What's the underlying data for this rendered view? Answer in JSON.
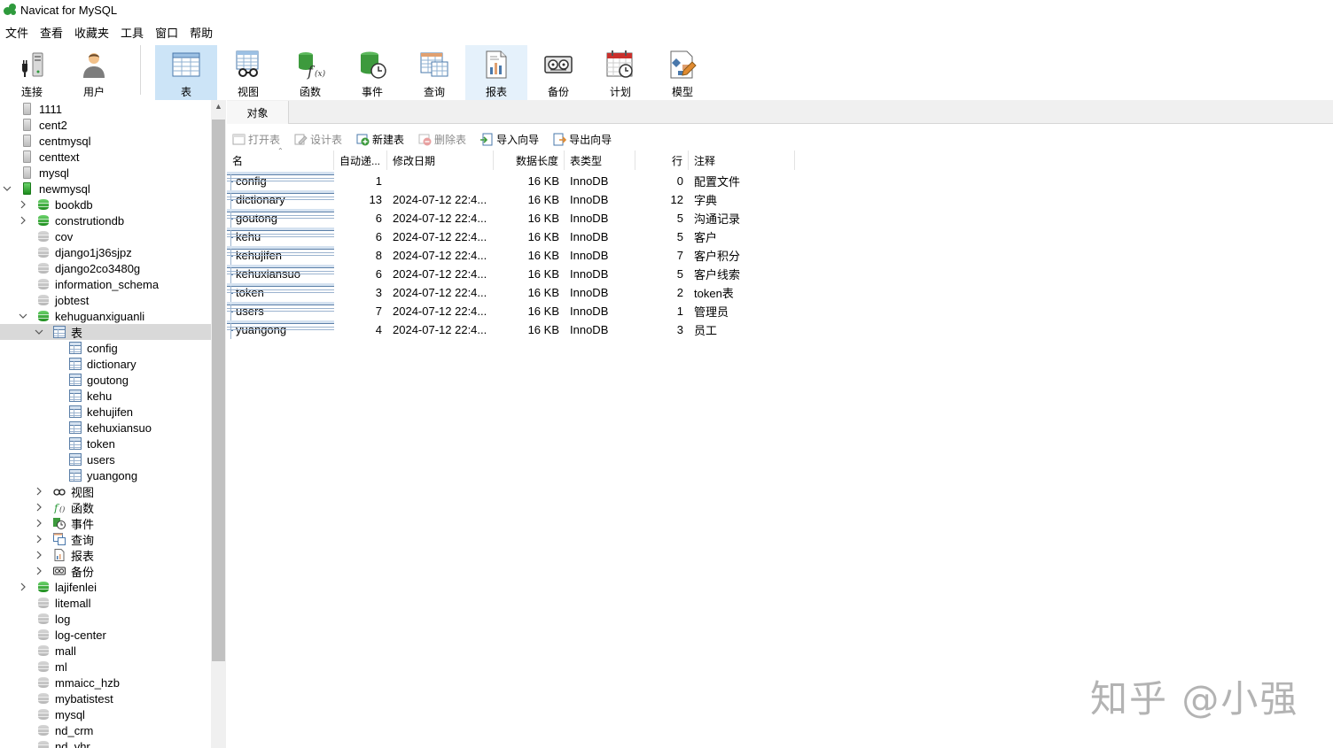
{
  "window": {
    "title": "Navicat for MySQL"
  },
  "menu": [
    "文件",
    "查看",
    "收藏夹",
    "工具",
    "窗口",
    "帮助"
  ],
  "toolbar": [
    {
      "key": "connect",
      "label": "连接"
    },
    {
      "key": "user",
      "label": "用户"
    },
    {
      "key": "table",
      "label": "表",
      "active": true
    },
    {
      "key": "view",
      "label": "视图"
    },
    {
      "key": "function",
      "label": "函数"
    },
    {
      "key": "event",
      "label": "事件"
    },
    {
      "key": "query",
      "label": "查询"
    },
    {
      "key": "report",
      "label": "报表",
      "hover": true
    },
    {
      "key": "backup",
      "label": "备份"
    },
    {
      "key": "schedule",
      "label": "计划"
    },
    {
      "key": "model",
      "label": "模型"
    }
  ],
  "tree": [
    {
      "label": "1111",
      "level": 0,
      "kind": "server"
    },
    {
      "label": "cent2",
      "level": 0,
      "kind": "server"
    },
    {
      "label": "centmysql",
      "level": 0,
      "kind": "server"
    },
    {
      "label": "centtext",
      "level": 0,
      "kind": "server"
    },
    {
      "label": "mysql",
      "level": 0,
      "kind": "server"
    },
    {
      "label": "newmysql",
      "level": 0,
      "kind": "server-on",
      "expanded": true
    },
    {
      "label": "bookdb",
      "level": 1,
      "kind": "db-on",
      "collapsed": true
    },
    {
      "label": "construtiondb",
      "level": 1,
      "kind": "db-on",
      "collapsed": true
    },
    {
      "label": "cov",
      "level": 1,
      "kind": "db"
    },
    {
      "label": "django1j36sjpz",
      "level": 1,
      "kind": "db"
    },
    {
      "label": "django2co3480g",
      "level": 1,
      "kind": "db"
    },
    {
      "label": "information_schema",
      "level": 1,
      "kind": "db"
    },
    {
      "label": "jobtest",
      "level": 1,
      "kind": "db"
    },
    {
      "label": "kehuguanxiguanli",
      "level": 1,
      "kind": "db-on",
      "expanded": true
    },
    {
      "label": "表",
      "level": 2,
      "kind": "tables",
      "expanded": true,
      "selected": true
    },
    {
      "label": "config",
      "level": 3,
      "kind": "table"
    },
    {
      "label": "dictionary",
      "level": 3,
      "kind": "table"
    },
    {
      "label": "goutong",
      "level": 3,
      "kind": "table"
    },
    {
      "label": "kehu",
      "level": 3,
      "kind": "table"
    },
    {
      "label": "kehujifen",
      "level": 3,
      "kind": "table"
    },
    {
      "label": "kehuxiansuo",
      "level": 3,
      "kind": "table"
    },
    {
      "label": "token",
      "level": 3,
      "kind": "table"
    },
    {
      "label": "users",
      "level": 3,
      "kind": "table"
    },
    {
      "label": "yuangong",
      "level": 3,
      "kind": "table"
    },
    {
      "label": "视图",
      "level": 2,
      "kind": "views",
      "collapsed": true
    },
    {
      "label": "函数",
      "level": 2,
      "kind": "functions",
      "collapsed": true
    },
    {
      "label": "事件",
      "level": 2,
      "kind": "events",
      "collapsed": true
    },
    {
      "label": "查询",
      "level": 2,
      "kind": "queries",
      "collapsed": true
    },
    {
      "label": "报表",
      "level": 2,
      "kind": "reports",
      "collapsed": true
    },
    {
      "label": "备份",
      "level": 2,
      "kind": "backups",
      "collapsed": true
    },
    {
      "label": "lajifenlei",
      "level": 1,
      "kind": "db-on",
      "collapsed": true
    },
    {
      "label": "litemall",
      "level": 1,
      "kind": "db"
    },
    {
      "label": "log",
      "level": 1,
      "kind": "db"
    },
    {
      "label": "log-center",
      "level": 1,
      "kind": "db"
    },
    {
      "label": "mall",
      "level": 1,
      "kind": "db"
    },
    {
      "label": "ml",
      "level": 1,
      "kind": "db"
    },
    {
      "label": "mmaicc_hzb",
      "level": 1,
      "kind": "db"
    },
    {
      "label": "mybatistest",
      "level": 1,
      "kind": "db"
    },
    {
      "label": "mysql",
      "level": 1,
      "kind": "db"
    },
    {
      "label": "nd_crm",
      "level": 1,
      "kind": "db"
    },
    {
      "label": "nd_vhr",
      "level": 1,
      "kind": "db"
    }
  ],
  "tab": {
    "label": "对象"
  },
  "object_toolbar": [
    {
      "key": "open",
      "label": "打开表",
      "enabled": false
    },
    {
      "key": "design",
      "label": "设计表",
      "enabled": false
    },
    {
      "key": "new",
      "label": "新建表",
      "enabled": true
    },
    {
      "key": "delete",
      "label": "删除表",
      "enabled": false
    },
    {
      "key": "import",
      "label": "导入向导",
      "enabled": true
    },
    {
      "key": "export",
      "label": "导出向导",
      "enabled": true
    }
  ],
  "grid": {
    "columns": [
      "名",
      "自动递...",
      "修改日期",
      "数据长度",
      "表类型",
      "行",
      "注释"
    ],
    "rows": [
      [
        "config",
        "1",
        "",
        "16 KB",
        "InnoDB",
        "0",
        "配置文件"
      ],
      [
        "dictionary",
        "13",
        "2024-07-12 22:4...",
        "16 KB",
        "InnoDB",
        "12",
        "字典"
      ],
      [
        "goutong",
        "6",
        "2024-07-12 22:4...",
        "16 KB",
        "InnoDB",
        "5",
        "沟通记录"
      ],
      [
        "kehu",
        "6",
        "2024-07-12 22:4...",
        "16 KB",
        "InnoDB",
        "5",
        "客户"
      ],
      [
        "kehujifen",
        "8",
        "2024-07-12 22:4...",
        "16 KB",
        "InnoDB",
        "7",
        "客户积分"
      ],
      [
        "kehuxiansuo",
        "6",
        "2024-07-12 22:4...",
        "16 KB",
        "InnoDB",
        "5",
        "客户线索"
      ],
      [
        "token",
        "3",
        "2024-07-12 22:4...",
        "16 KB",
        "InnoDB",
        "2",
        "token表"
      ],
      [
        "users",
        "7",
        "2024-07-12 22:4...",
        "16 KB",
        "InnoDB",
        "1",
        "管理员"
      ],
      [
        "yuangong",
        "4",
        "2024-07-12 22:4...",
        "16 KB",
        "InnoDB",
        "3",
        "员工"
      ]
    ]
  },
  "watermark": "知乎 @小强",
  "colors": {
    "selected_toolbar": "#cce4f7",
    "tree_selected": "#d9d9d9",
    "db_active": "#2e9a3c"
  }
}
